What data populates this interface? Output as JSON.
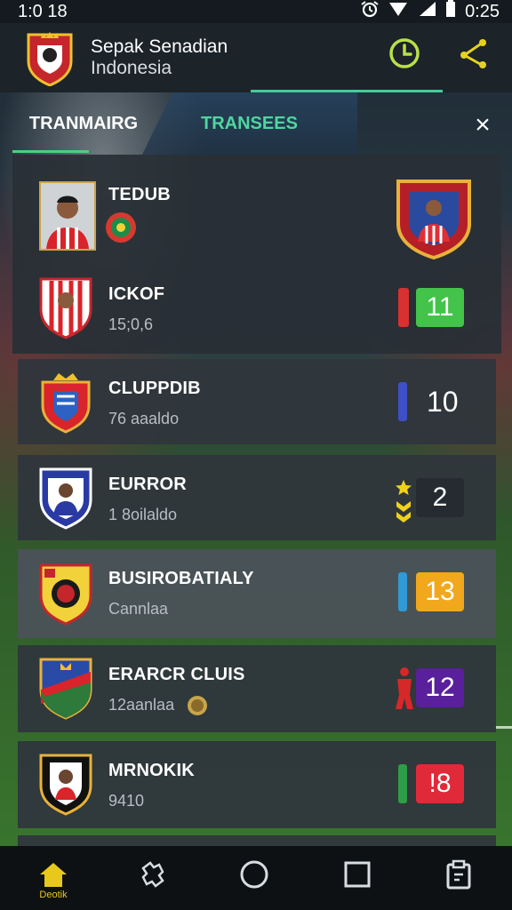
{
  "status_bar": {
    "time": "1:0 18",
    "clock": "0:25"
  },
  "header": {
    "title_line1": "Sepak Senadian",
    "title_line2": "Indonesia"
  },
  "tabs": {
    "tab1": "TRANMAIRG",
    "tab2": "TRANSEES",
    "close": "×"
  },
  "rows": [
    {
      "name": "ТЕDUB",
      "sub": ""
    },
    {
      "name": "ICKOF",
      "sub": "15;0,6",
      "badge": "11",
      "badge_color": "#43c34a",
      "marker_color": "#d93030"
    },
    {
      "name": "CLUPPDIB",
      "sub": "76 aaaldo",
      "value": "10",
      "marker_color": "#3f4fc8"
    },
    {
      "name": "EURROR",
      "sub": "1 8oilaldo",
      "badge": "2",
      "badge_color": "#252b31",
      "marker_color": "#f0d21a"
    },
    {
      "name": "BUSIROBATIALY",
      "sub": "Cannlaa",
      "badge": "13",
      "badge_color": "#f2a81c",
      "marker_color": "#2f9ad6"
    },
    {
      "name": "ERARCR CLUIS",
      "sub": "12aanlaa",
      "badge": "12",
      "badge_color": "#5a1f9c",
      "marker_color": "#d52828"
    },
    {
      "name": "MRNOKIK",
      "sub": "9410",
      "badge": "!8",
      "badge_color": "#e02a3a",
      "marker_color": "#2d9e47"
    }
  ],
  "nav": {
    "home_label": "Deotik"
  },
  "colors": {
    "accent": "#4fd6a0",
    "header_bg": "#1c2329",
    "card_bg": "#2f363c"
  }
}
